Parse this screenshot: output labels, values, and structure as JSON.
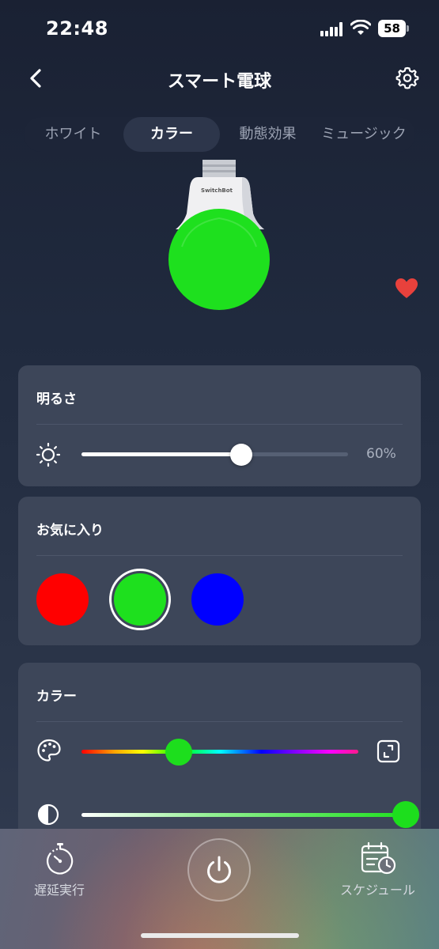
{
  "status_bar": {
    "time": "22:48",
    "battery": "58"
  },
  "nav": {
    "title": "スマート電球"
  },
  "tabs": [
    {
      "label": "ホワイト",
      "active": false
    },
    {
      "label": "カラー",
      "active": true
    },
    {
      "label": "動態効果",
      "active": false
    },
    {
      "label": "ミュージック",
      "active": false
    }
  ],
  "bulb": {
    "brand": "SwitchBot",
    "color": "#1ee01e"
  },
  "brightness": {
    "title": "明るさ",
    "value": 60,
    "value_label": "60%"
  },
  "favorites": {
    "title": "お気に入り",
    "swatches": [
      {
        "color": "#ff0000",
        "selected": false
      },
      {
        "color": "#1ee01e",
        "selected": true
      },
      {
        "color": "#0000ff",
        "selected": false
      }
    ]
  },
  "color": {
    "title": "カラー",
    "hue_position": 0.35,
    "saturation_position": 1.0,
    "knob_color": "#1dde1d"
  },
  "bottom": {
    "timer_label": "遅延実行",
    "schedule_label": "スケジュール"
  },
  "colors": {
    "accent_green": "#1ee01e",
    "heart": "#e8413c"
  }
}
